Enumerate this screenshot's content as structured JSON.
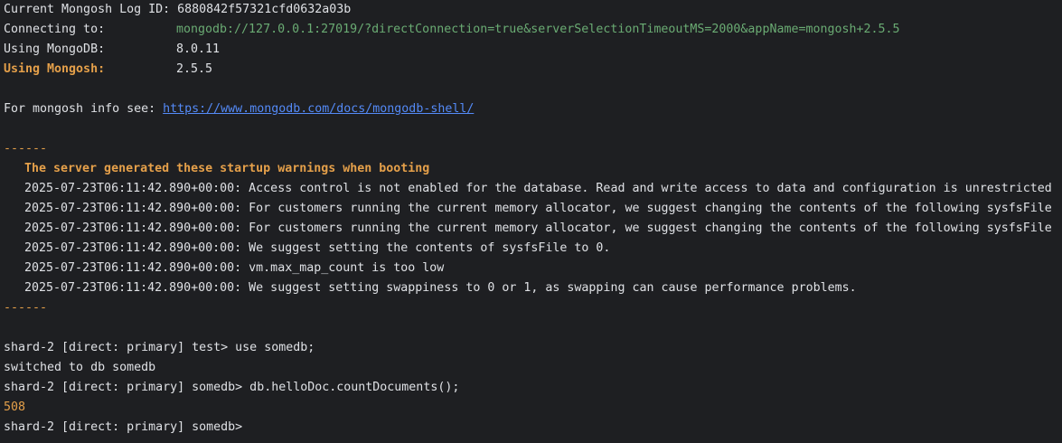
{
  "header": {
    "log_id_line": "Current Mongosh Log ID: 6880842f57321cfd0632a03b",
    "connecting_label": "Connecting to:",
    "connecting_value": "mongodb://127.0.0.1:27019/?directConnection=true&serverSelectionTimeoutMS=2000&appName=mongosh+2.5.5",
    "mongodb_label": "Using MongoDB:",
    "mongodb_value": "8.0.11",
    "mongosh_label": "Using Mongosh:",
    "mongosh_value": "2.5.5"
  },
  "info": {
    "prefix": "For mongosh info see: ",
    "link": "https://www.mongodb.com/docs/mongodb-shell/"
  },
  "warnings": {
    "separator": "------",
    "title": "The server generated these startup warnings when booting",
    "items": [
      "2025-07-23T06:11:42.890+00:00: Access control is not enabled for the database. Read and write access to data and configuration is unrestricted",
      "2025-07-23T06:11:42.890+00:00: For customers running the current memory allocator, we suggest changing the contents of the following sysfsFile",
      "2025-07-23T06:11:42.890+00:00: For customers running the current memory allocator, we suggest changing the contents of the following sysfsFile",
      "2025-07-23T06:11:42.890+00:00: We suggest setting the contents of sysfsFile to 0.",
      "2025-07-23T06:11:42.890+00:00: vm.max_map_count is too low",
      "2025-07-23T06:11:42.890+00:00: We suggest setting swappiness to 0 or 1, as swapping can cause performance problems."
    ]
  },
  "session": {
    "cmd1": "shard-2 [direct: primary] test> use somedb;",
    "out1": "switched to db somedb",
    "cmd2": "shard-2 [direct: primary] somedb> db.helloDoc.countDocuments();",
    "out2": "508",
    "prompt": "shard-2 [direct: primary] somedb> "
  },
  "colors": {
    "background": "#1e1f22",
    "text": "#dfe1e5",
    "green": "#6aab73",
    "orange": "#e5a04a",
    "link": "#548af7"
  }
}
